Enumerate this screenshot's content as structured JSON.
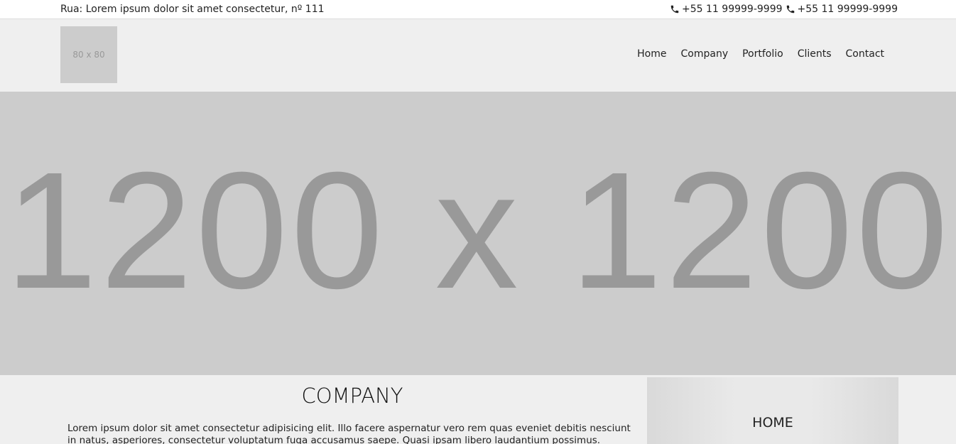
{
  "topbar": {
    "address": "Rua: Lorem ipsum dolor sit amet consectetur, nº 111",
    "phones": [
      "+55 11 99999-9999",
      "+55 11 99999-9999"
    ],
    "phone_icon": "phone-icon"
  },
  "header": {
    "logo_placeholder": "80 x 80",
    "nav": [
      "Home",
      "Company",
      "Portfolio",
      "Clients",
      "Contact"
    ]
  },
  "hero": {
    "placeholder": "1200 x 1200"
  },
  "company": {
    "title": "COMPANY",
    "text": "Lorem ipsum dolor sit amet consectetur adipisicing elit. Illo facere aspernatur vero rem quas eveniet debitis nesciunt in natus, asperiores, consectetur voluptatum fuga accusamus saepe. Quasi ipsam libero laudantium possimus."
  },
  "side_panel": {
    "title": "HOME"
  },
  "colors": {
    "topbar_bg": "#ffffff",
    "page_bg": "#efefef",
    "placeholder_bg": "#cccccc",
    "placeholder_text": "#999999"
  }
}
